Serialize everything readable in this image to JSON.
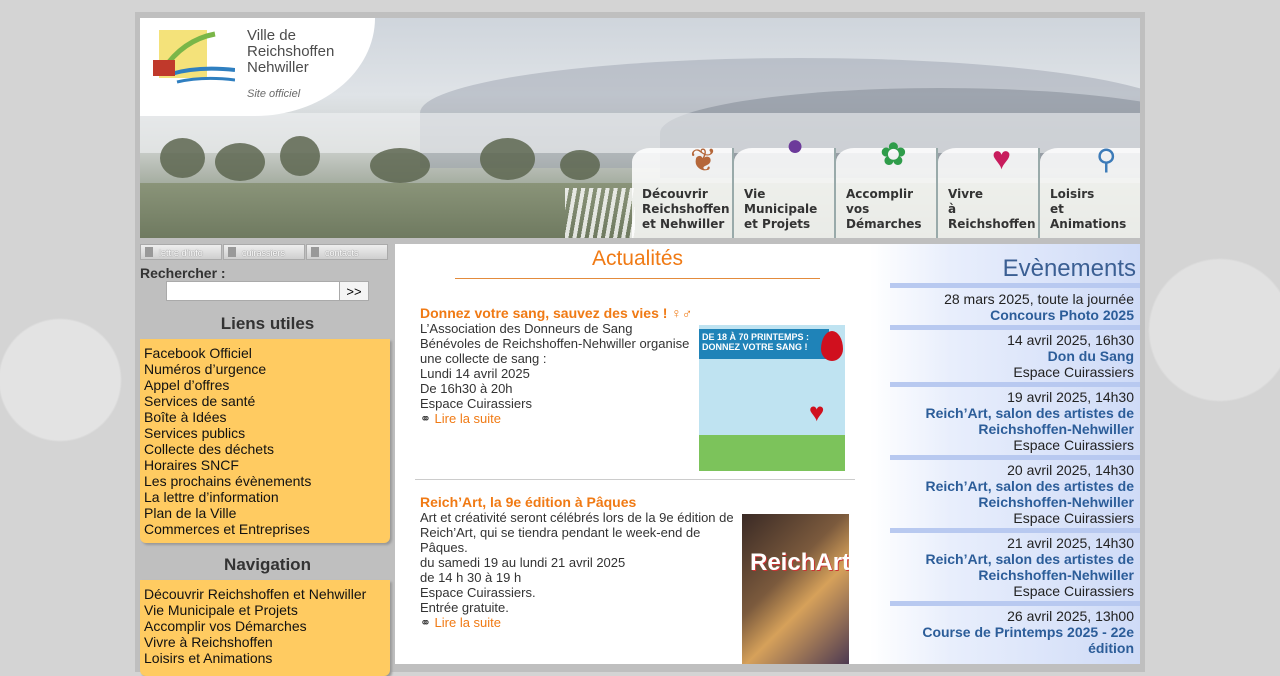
{
  "site": {
    "logo_lines": [
      "Ville de",
      "Reichshoffen",
      "Nehwiller"
    ],
    "logo_sub": "Site officiel"
  },
  "nav_tabs": [
    {
      "l1": "Découvrir",
      "l2": "Reichshoffen",
      "l3": "et Nehwiller",
      "icon": "leaf-icon"
    },
    {
      "l1": "Vie",
      "l2": "Municipale",
      "l3": "et Projets",
      "icon": "grapes-icon"
    },
    {
      "l1": "Accomplir",
      "l2": "vos",
      "l3": "Démarches",
      "icon": "plant-icon"
    },
    {
      "l1": "Vivre",
      "l2": "à",
      "l3": "Reichshoffen",
      "icon": "butterfly-icon"
    },
    {
      "l1": "Loisirs",
      "l2": "et",
      "l3": "Animations",
      "icon": "bicycle-icon"
    }
  ],
  "quicklinks": [
    "lettre d'info",
    "cuirassiers",
    "contacts"
  ],
  "search": {
    "label": "Rechercher :",
    "button": ">>",
    "value": ""
  },
  "useful_links": {
    "title": "Liens utiles",
    "items": [
      "Facebook Officiel",
      "Numéros d’urgence",
      "Appel d’offres",
      "Services de santé",
      "Boîte à Idées",
      "Services publics",
      "Collecte des déchets",
      "Horaires SNCF",
      "Les prochains évènements",
      "La lettre d’information",
      "Plan de la Ville",
      "Commerces et Entreprises"
    ]
  },
  "navigation": {
    "title": "Navigation",
    "items": [
      "Découvrir Reichshoffen et Nehwiller",
      "Vie Municipale et Projets",
      "Accomplir vos Démarches",
      "Vivre à Reichshoffen",
      "Loisirs et Animations"
    ]
  },
  "main": {
    "title": "Actualités",
    "articles": [
      {
        "title": " Donnez votre sang, sauvez des vies ! ♀‍♂",
        "lines": [
          "L’Association des Donneurs de Sang",
          "Bénévoles de Reichshoffen-Nehwiller organise",
          "une collecte de sang :",
          " Lundi 14 avril 2025",
          " De 16h30 à 20h",
          " Espace Cuirassiers"
        ],
        "more": "Lire la suite",
        "poster_band": "DE 18 À 70 PRINTEMPS : DONNEZ VOTRE SANG !"
      },
      {
        "title": "Reich’Art, la 9e édition à Pâques",
        "lines": [
          "Art et créativité seront célébrés lors de la 9e édition de",
          "Reich’Art, qui se tiendra pendant le week-end de",
          "Pâques.",
          " du samedi 19 au lundi 21 avril 2025",
          " de 14 h 30 à 19 h",
          " Espace Cuirassiers.",
          "Entrée gratuite."
        ],
        "more": "Lire la suite",
        "poster_text": "ReichArt"
      }
    ]
  },
  "events": {
    "title": "Evènements",
    "items": [
      {
        "date": "28 mars 2025, toute la journée",
        "title": [
          "Concours Photo 2025"
        ],
        "place": ""
      },
      {
        "date": "14 avril 2025, 16h30",
        "title": [
          "Don du Sang"
        ],
        "place": "Espace Cuirassiers"
      },
      {
        "date": "19 avril 2025, 14h30",
        "title": [
          "Reich’Art, salon des artistes de",
          "Reichshoffen-Nehwiller"
        ],
        "place": "Espace Cuirassiers"
      },
      {
        "date": "20 avril 2025, 14h30",
        "title": [
          "Reich’Art, salon des artistes de",
          "Reichshoffen-Nehwiller"
        ],
        "place": "Espace Cuirassiers"
      },
      {
        "date": "21 avril 2025, 14h30",
        "title": [
          "Reich’Art, salon des artistes de",
          "Reichshoffen-Nehwiller"
        ],
        "place": "Espace Cuirassiers"
      },
      {
        "date": "26 avril 2025, 13h00",
        "title": [
          "Course de Printemps 2025 - 22e",
          "édition"
        ],
        "place": ""
      }
    ]
  }
}
